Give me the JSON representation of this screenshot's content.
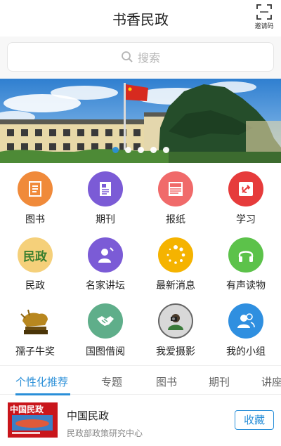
{
  "header": {
    "title": "书香民政",
    "invite_label": "邀请码"
  },
  "search": {
    "placeholder": "搜索"
  },
  "banner": {
    "dots": 5,
    "active_dot": 1
  },
  "categories": [
    {
      "label": "图书",
      "icon": "book-icon",
      "color": "#f08a3a"
    },
    {
      "label": "期刊",
      "icon": "magazine-icon",
      "color": "#7b5bd6"
    },
    {
      "label": "报纸",
      "icon": "newspaper-icon",
      "color": "#f06a6a"
    },
    {
      "label": "学习",
      "icon": "party-emblem-icon",
      "color": "#e63b3b"
    },
    {
      "label": "民政",
      "icon": "minzheng-icon",
      "color": "#f5d07a",
      "icon_text": "民政"
    },
    {
      "label": "名家讲坛",
      "icon": "lecture-icon",
      "color": "#7b5bd6"
    },
    {
      "label": "最新消息",
      "icon": "loading-icon",
      "color": "#f5b300"
    },
    {
      "label": "有声读物",
      "icon": "headphones-icon",
      "color": "#5cc24a"
    },
    {
      "label": "孺子牛奖",
      "icon": "bull-statue-icon",
      "color": "#b8871f"
    },
    {
      "label": "国图借阅",
      "icon": "handshake-icon",
      "color": "#5fae8a"
    },
    {
      "label": "我爱摄影",
      "icon": "photography-icon",
      "color": "#d8d8d8"
    },
    {
      "label": "我的小组",
      "icon": "group-icon",
      "color": "#2f8fe0"
    }
  ],
  "tabs": [
    {
      "label": "个性化推荐",
      "active": true
    },
    {
      "label": "专题",
      "active": false
    },
    {
      "label": "图书",
      "active": false
    },
    {
      "label": "期刊",
      "active": false
    },
    {
      "label": "讲座",
      "active": false
    }
  ],
  "recommendation": {
    "cover_title": "中国民政",
    "title": "中国民政",
    "publisher": "民政部政策研究中心",
    "favorite_label": "收藏"
  },
  "colors": {
    "accent": "#2a8fd8"
  }
}
